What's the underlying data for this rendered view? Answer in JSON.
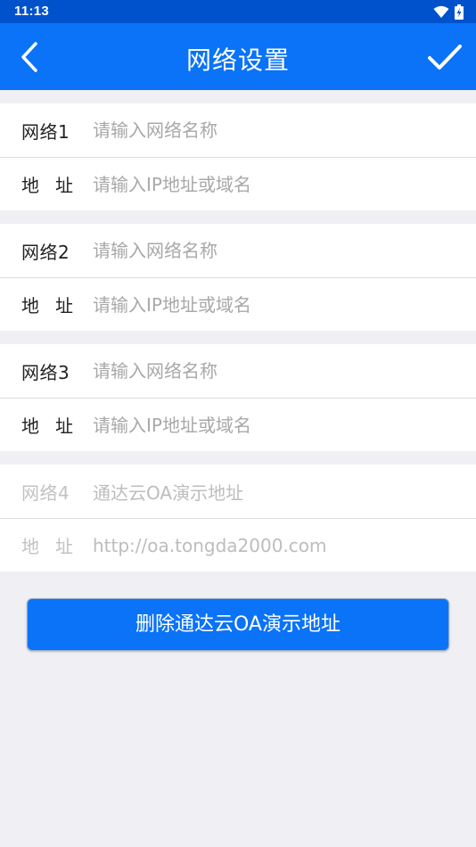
{
  "status_bar": {
    "time": "11:13",
    "icons": [
      "wifi-icon",
      "battery-charging-icon"
    ]
  },
  "header": {
    "title": "网络设置",
    "back_icon": "chevron-left-icon",
    "confirm_icon": "check-icon"
  },
  "networks": [
    {
      "name_label": "网络1",
      "name_placeholder": "请输入网络名称",
      "address_label": "地址",
      "address_placeholder": "请输入IP地址或域名"
    },
    {
      "name_label": "网络2",
      "name_placeholder": "请输入网络名称",
      "address_label": "地址",
      "address_placeholder": "请输入IP地址或域名"
    },
    {
      "name_label": "网络3",
      "name_placeholder": "请输入网络名称",
      "address_label": "地址",
      "address_placeholder": "请输入IP地址或域名"
    }
  ],
  "demo_network": {
    "name_label": "网络4",
    "name_value": "通达云OA演示地址",
    "address_label": "地址",
    "address_value": "http://oa.tongda2000.com"
  },
  "delete_button": {
    "label": "删除通达云OA演示地址"
  },
  "colors": {
    "status_bar": "#0052cc",
    "app_bar": "#0a73f7",
    "background": "#efeff4",
    "placeholder": "#a8a8a8"
  }
}
